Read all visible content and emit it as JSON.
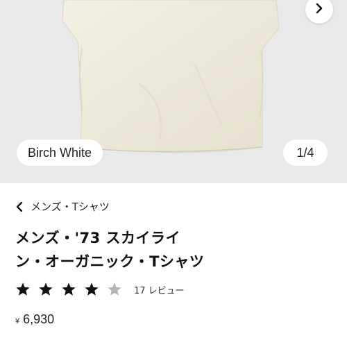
{
  "gallery": {
    "color_name": "Birch White",
    "counter": "1/4",
    "next_icon": "chevron-right-icon"
  },
  "breadcrumb": {
    "icon": "chevron-left-icon",
    "label": "メンズ・Tシャツ"
  },
  "product": {
    "title_line1": "メンズ・'73 スカイライ",
    "title_line2": "ン・オーガニック・Tシャツ",
    "rating": 4,
    "rating_max": 5,
    "reviews_label": "17 レビュー",
    "currency": "¥",
    "price": "6,930"
  },
  "colors": {
    "star_filled": "#111111",
    "star_empty": "#b5b5b5",
    "gallery_bg": "#e9e9e9",
    "shirt": "#efecdd"
  }
}
